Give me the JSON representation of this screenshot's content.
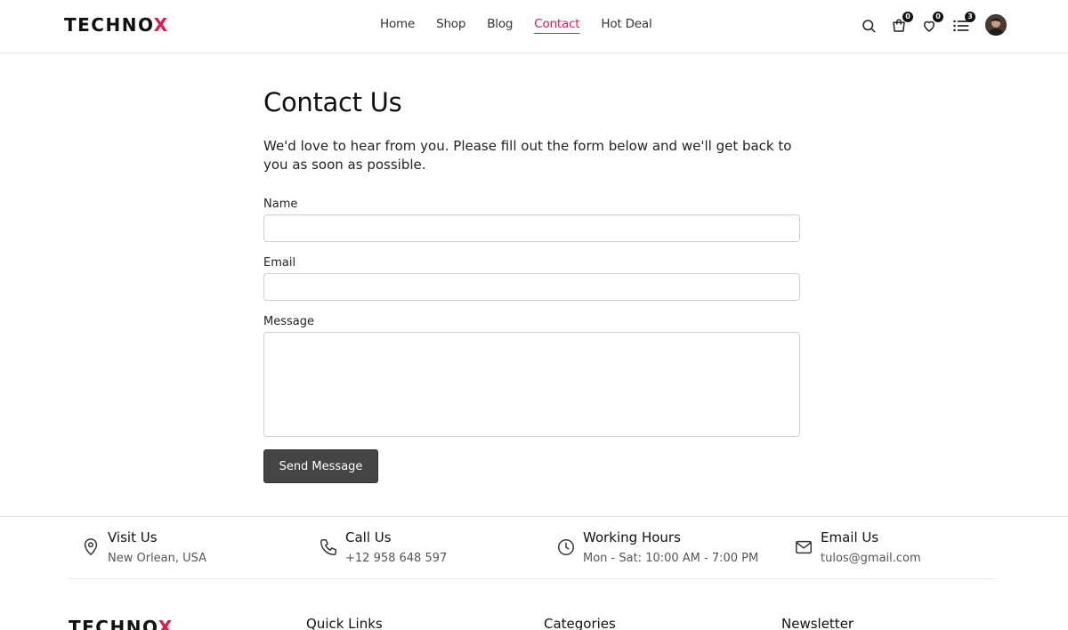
{
  "header": {
    "logo_main": "TECHNO",
    "logo_accent": "X",
    "nav": [
      {
        "label": "Home"
      },
      {
        "label": "Shop"
      },
      {
        "label": "Blog"
      },
      {
        "label": "Contact",
        "active": true
      },
      {
        "label": "Hot Deal"
      }
    ],
    "cart_count": "0",
    "wishlist_count": "0",
    "compare_count": "3",
    "icons": [
      "search-icon",
      "cart-icon",
      "heart-icon",
      "grid-menu-icon",
      "avatar"
    ]
  },
  "contact": {
    "title": "Contact Us",
    "intro": "We'd love to hear from you. Please fill out the form below and we'll get back to you as soon as possible.",
    "name_label": "Name",
    "name_value": "",
    "email_label": "Email",
    "email_value": "",
    "message_label": "Message",
    "message_value": "",
    "submit_label": "Send Message"
  },
  "info": [
    {
      "title": "Visit Us",
      "text": "New Orlean, USA",
      "icon": "location-pin-icon"
    },
    {
      "title": "Call Us",
      "text": "+12 958 648 597",
      "icon": "phone-icon"
    },
    {
      "title": "Working Hours",
      "text": "Mon - Sat: 10:00 AM - 7:00 PM",
      "icon": "clock-icon"
    },
    {
      "title": "Email Us",
      "text": "tulos@gmail.com",
      "icon": "mail-icon"
    }
  ],
  "footer": {
    "logo_main": "TECHNO",
    "logo_accent": "X",
    "headings": [
      "Quick Links",
      "Categories",
      "Newsletter"
    ]
  },
  "colors": {
    "accent": "#e8174b",
    "button": "#444444",
    "border": "#cfcfcf"
  }
}
